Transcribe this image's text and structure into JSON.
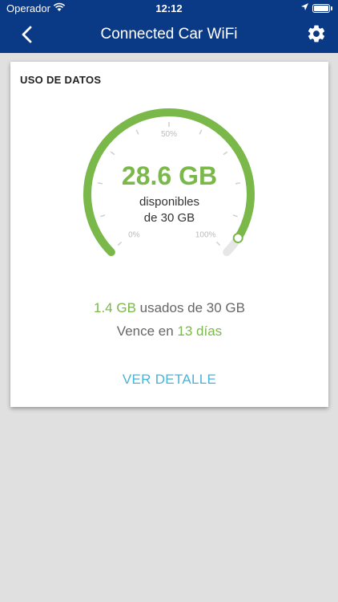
{
  "status_bar": {
    "carrier": "Operador",
    "time": "12:12"
  },
  "navbar": {
    "title": "Connected Car WiFi",
    "back_icon": "chevron-left-icon",
    "settings_icon": "gear-icon"
  },
  "card": {
    "title": "USO DE DATOS",
    "gauge": {
      "available_fraction": 0.953,
      "label_min": "0%",
      "label_mid": "50%",
      "label_max": "100%"
    },
    "available_value": "28.6 GB",
    "available_label": "disponibles",
    "available_of": "de 30 GB",
    "used_value": "1.4 GB",
    "used_text": " usados de 30 GB",
    "expires_prefix": "Vence en ",
    "expires_value": "13 días",
    "detail_link": "VER DETALLE"
  },
  "colors": {
    "header": "#0a3a86",
    "accent_green": "#7ab84a",
    "link_blue": "#4ab3d8",
    "background": "#e0e0e0"
  }
}
